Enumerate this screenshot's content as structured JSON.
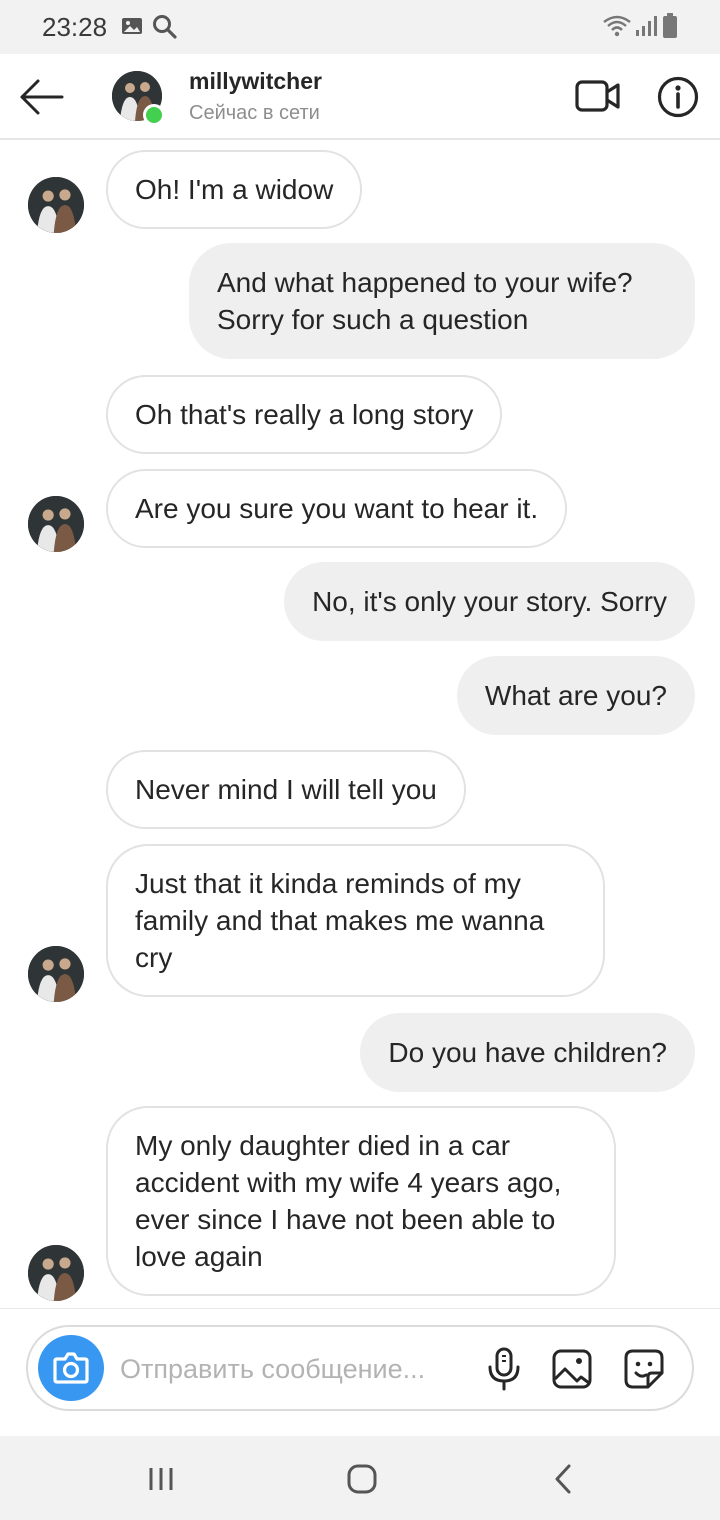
{
  "status_bar": {
    "time": "23:28",
    "icons": [
      "gallery-notification-icon",
      "search-notification-icon",
      "wifi-icon",
      "signal-icon",
      "battery-icon"
    ]
  },
  "header": {
    "username": "millywitcher",
    "status": "Сейчас в сети",
    "online": true,
    "icons": [
      "back-arrow-icon",
      "video-call-icon",
      "info-icon"
    ]
  },
  "messages": [
    {
      "side": "in",
      "text": "Oh! I'm a widow",
      "avatar": true
    },
    {
      "side": "out",
      "text": "And what happened to your wife?\nSorry for such a question",
      "avatar": false
    },
    {
      "side": "in",
      "text": "Oh that's really a long story",
      "avatar": false
    },
    {
      "side": "in",
      "text": "Are you sure you want to hear it.",
      "avatar": true
    },
    {
      "side": "out",
      "text": "No, it's only your story. Sorry",
      "avatar": false
    },
    {
      "side": "out",
      "text": "What are you?",
      "avatar": false
    },
    {
      "side": "in",
      "text": "Never mind I will tell you",
      "avatar": false
    },
    {
      "side": "in",
      "text": "Just that it kinda reminds of my\nfamily and that makes me wanna\ncry",
      "avatar": true
    },
    {
      "side": "out",
      "text": "Do you have children?",
      "avatar": false
    },
    {
      "side": "in",
      "text": "My only daughter died in a car\naccident with my wife 4 years ago,\never since I have not been able to\nlove again",
      "avatar": true
    }
  ],
  "composer": {
    "placeholder": "Отправить сообщение...",
    "value": "",
    "icons": [
      "camera-icon",
      "microphone-icon",
      "gallery-icon",
      "sticker-icon"
    ]
  },
  "nav_bar": {
    "icons": [
      "recent-apps-icon",
      "home-icon",
      "back-icon"
    ]
  },
  "colors": {
    "accent": "#3897f0",
    "online": "#44d04f",
    "outgoing_bubble": "#efefef",
    "incoming_border": "#e2e2e2"
  }
}
